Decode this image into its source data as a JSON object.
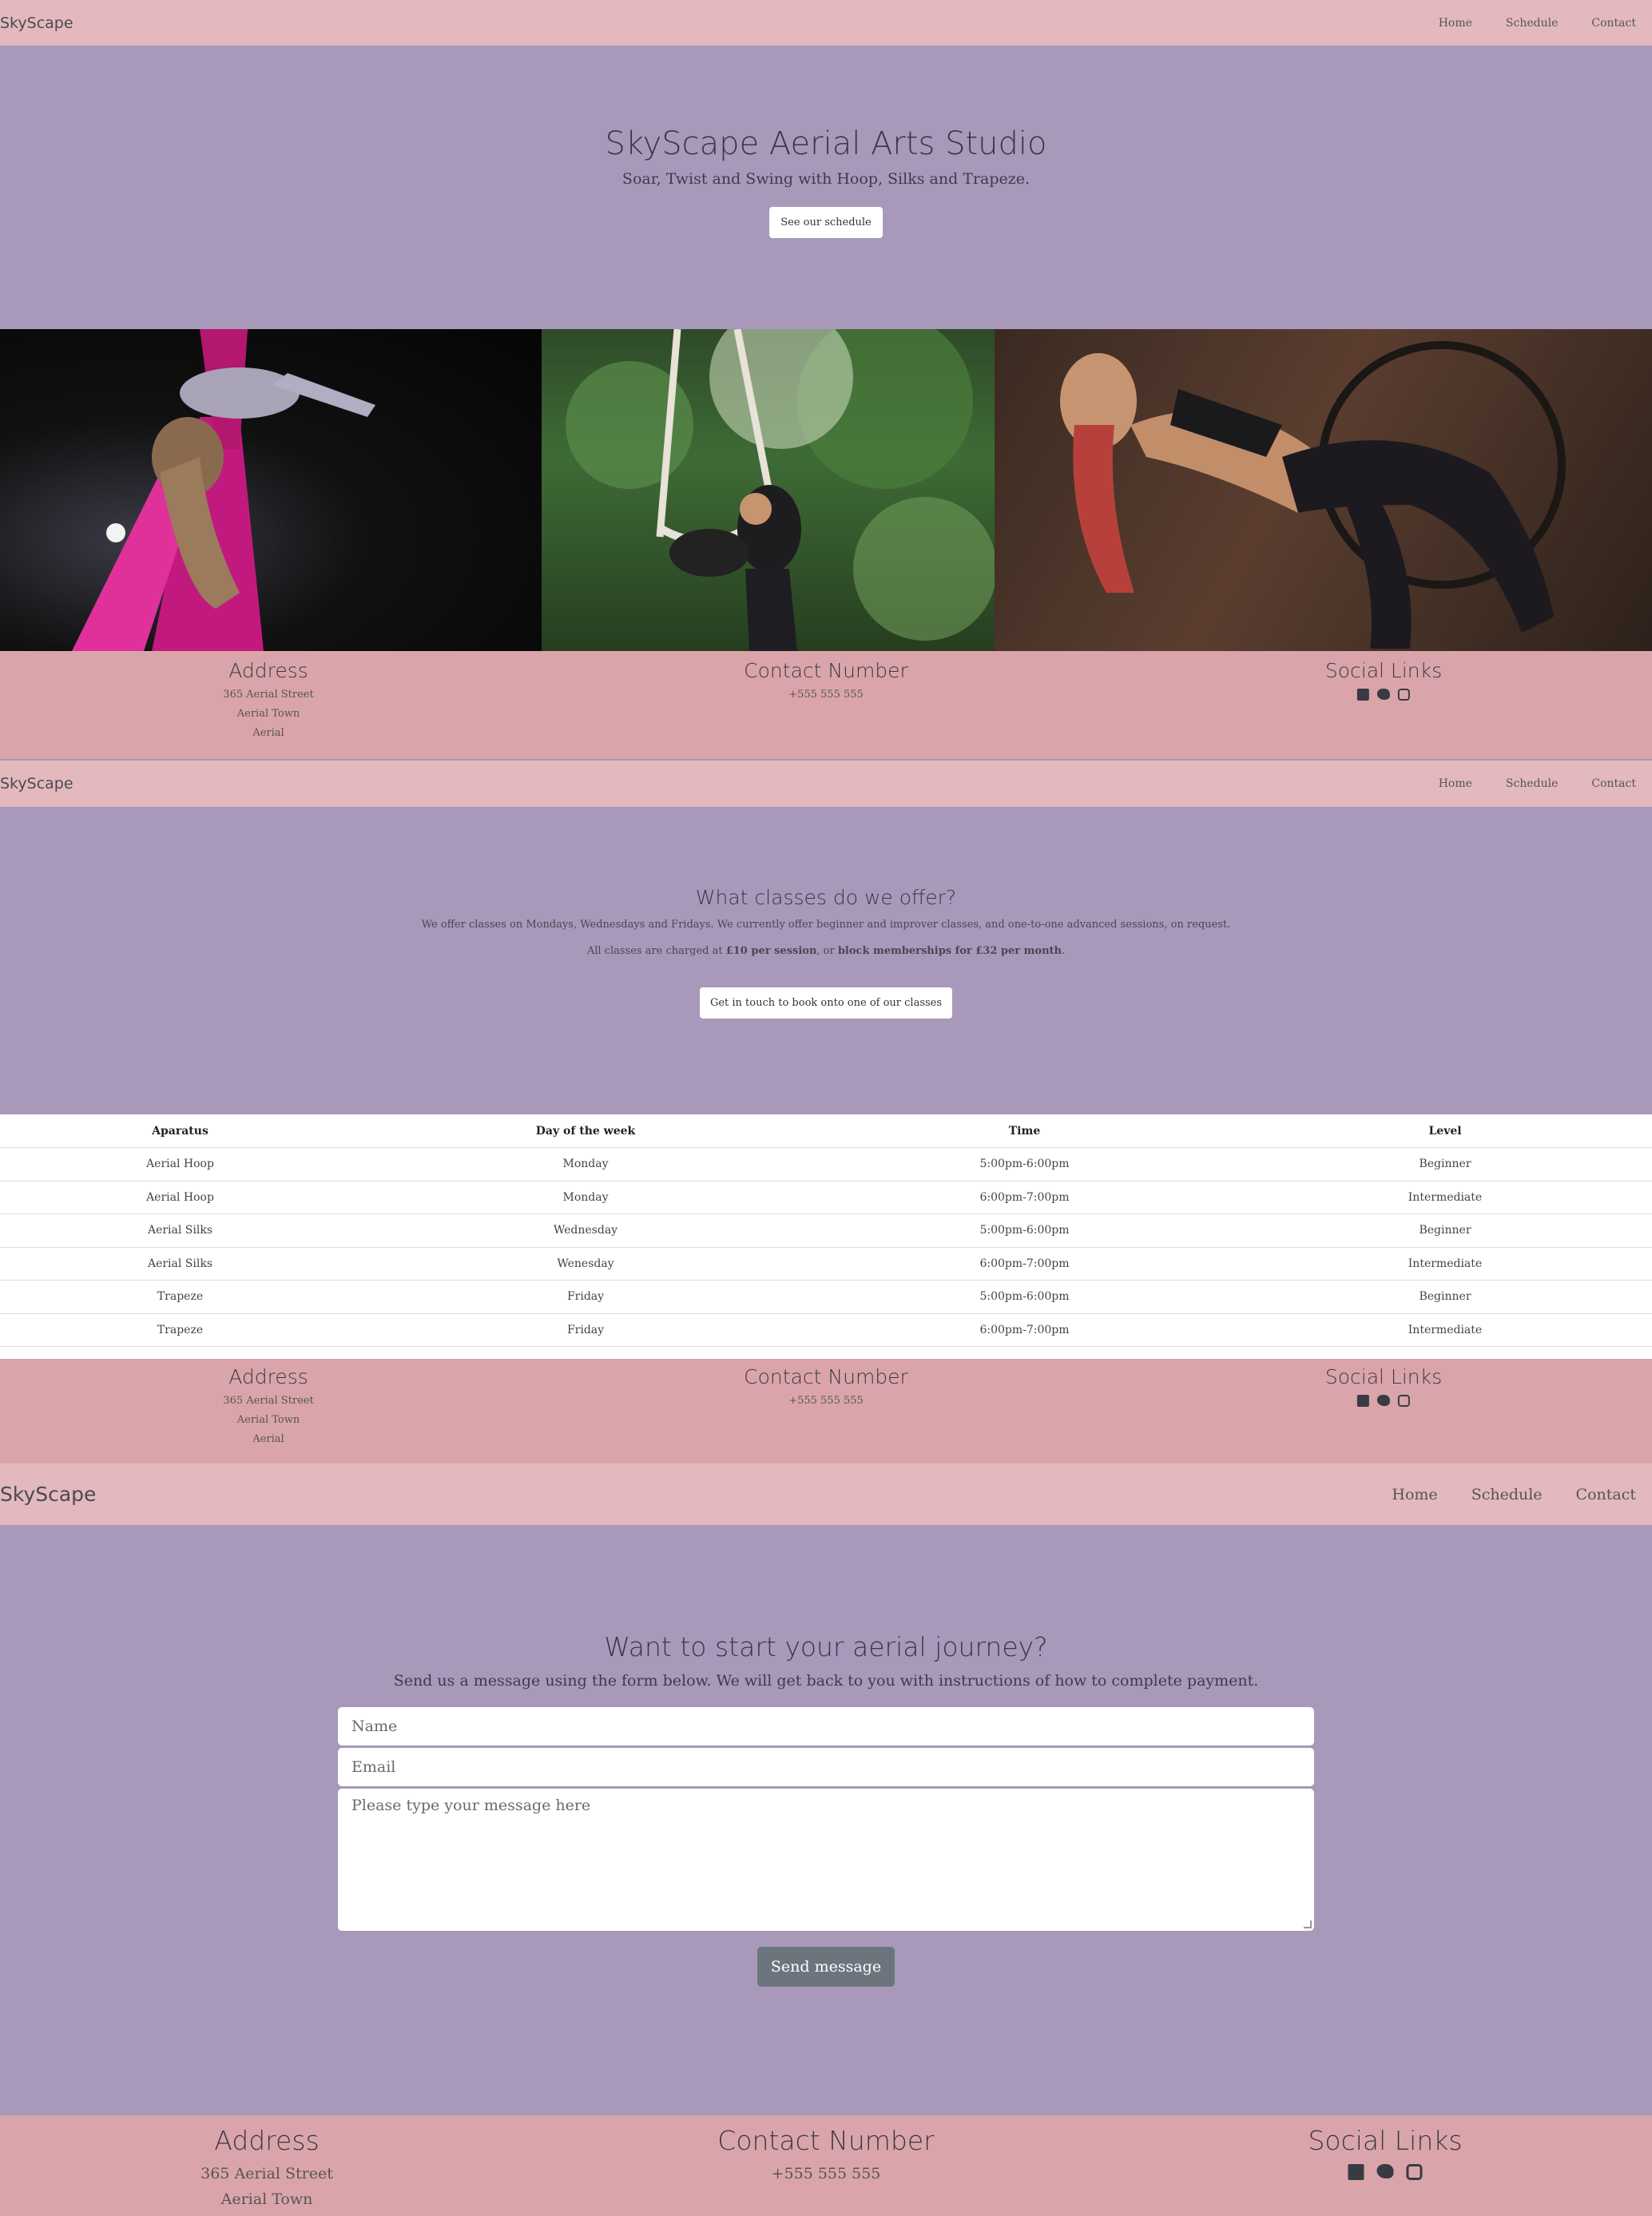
{
  "brand": "SkyScape",
  "nav": [
    "Home",
    "Schedule",
    "Contact"
  ],
  "hero": {
    "title": "SkyScape Aerial Arts Studio",
    "subtitle": "Soar, Twist and Swing with Hoop, Silks and Trapeze.",
    "button": "See our schedule"
  },
  "footer": {
    "address_title": "Address",
    "address_lines": [
      "365 Aerial Street",
      "Aerial Town",
      "Aerial"
    ],
    "contact_title": "Contact Number",
    "phone": "+555 555 555",
    "social_title": "Social Links",
    "social_icons": [
      "facebook-icon",
      "twitter-icon",
      "instagram-icon"
    ]
  },
  "classes": {
    "title": "What classes do we offer?",
    "desc": "We offer classes on Mondays, Wednesdays and Fridays. We currently offer beginner and improver classes, and one-to-one advanced sessions, on request.",
    "price_prefix": "All classes are charged at ",
    "price_session": "£10 per session",
    "price_mid": ", or ",
    "price_block": "block memberships for £32 per month",
    "price_suffix": ".",
    "button": "Get in touch to book onto one of our classes"
  },
  "schedule": {
    "headers": [
      "Aparatus",
      "Day of the week",
      "Time",
      "Level"
    ],
    "rows": [
      [
        "Aerial Hoop",
        "Monday",
        "5:00pm-6:00pm",
        "Beginner"
      ],
      [
        "Aerial Hoop",
        "Monday",
        "6:00pm-7:00pm",
        "Intermediate"
      ],
      [
        "Aerial Silks",
        "Wednesday",
        "5:00pm-6:00pm",
        "Beginner"
      ],
      [
        "Aerial Silks",
        "Wenesday",
        "6:00pm-7:00pm",
        "Intermediate"
      ],
      [
        "Trapeze",
        "Friday",
        "5:00pm-6:00pm",
        "Beginner"
      ],
      [
        "Trapeze",
        "Friday",
        "6:00pm-7:00pm",
        "Intermediate"
      ]
    ]
  },
  "contact": {
    "title": "Want to start your aerial journey?",
    "subtitle": "Send us a message using the form below. We will get back to you with instructions of how to complete payment.",
    "name_placeholder": "Name",
    "email_placeholder": "Email",
    "message_placeholder": "Please type your message here",
    "button": "Send message"
  },
  "photos": [
    "aerial-silks-photo",
    "trapeze-photo",
    "aerial-hoop-photo"
  ]
}
